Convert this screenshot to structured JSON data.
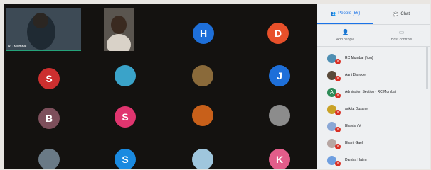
{
  "meeting": {
    "pinned_video": {
      "label": "RC Mumbai"
    },
    "tiles": [
      {
        "kind": "avatar",
        "letter": "H",
        "color": "#1e6fd9"
      },
      {
        "kind": "avatar",
        "letter": "D",
        "color": "#e8502a"
      },
      {
        "kind": "avatar",
        "letter": "S",
        "color": "#cc2f2f"
      },
      {
        "kind": "photo",
        "color": "#3aa3c9"
      },
      {
        "kind": "photo",
        "color": "#8a6a3a"
      },
      {
        "kind": "avatar",
        "letter": "J",
        "color": "#1e6fd9"
      },
      {
        "kind": "avatar",
        "letter": "B",
        "color": "#7d4f5b"
      },
      {
        "kind": "avatar",
        "letter": "S",
        "color": "#e0356f"
      },
      {
        "kind": "photo",
        "color": "#c8601a"
      },
      {
        "kind": "photo",
        "color": "#8c8c8c"
      },
      {
        "kind": "photo",
        "color": "#6a7a86"
      },
      {
        "kind": "avatar",
        "letter": "S",
        "color": "#1a8ae0"
      },
      {
        "kind": "photo",
        "color": "#9fc6dd"
      },
      {
        "kind": "avatar",
        "letter": "K",
        "color": "#e25d8a"
      }
    ]
  },
  "panel": {
    "tabs": [
      {
        "label": "People (56)",
        "icon": "people-icon",
        "active": true
      },
      {
        "label": "Chat",
        "icon": "chat-icon",
        "active": false
      }
    ],
    "actions": [
      {
        "label": "Add people",
        "icon": "add-person-icon"
      },
      {
        "label": "Host controls",
        "icon": "host-controls-icon"
      }
    ],
    "participants": [
      {
        "name": "RC Mumbai (You)",
        "color": "#4f8fb3",
        "initial": ""
      },
      {
        "name": "Aarti Banode",
        "color": "#5a4a3a",
        "initial": ""
      },
      {
        "name": "Admission Section - RC Mumbai",
        "color": "#2e8b57",
        "initial": "A"
      },
      {
        "name": "ankita Dusane",
        "color": "#c9a227",
        "initial": ""
      },
      {
        "name": "Bhavish V",
        "color": "#8aa7d6",
        "initial": ""
      },
      {
        "name": "Bharti Gael",
        "color": "#b7a6a2",
        "initial": ""
      },
      {
        "name": "Darsha Hatim",
        "color": "#6f9fe0",
        "initial": ""
      }
    ]
  }
}
